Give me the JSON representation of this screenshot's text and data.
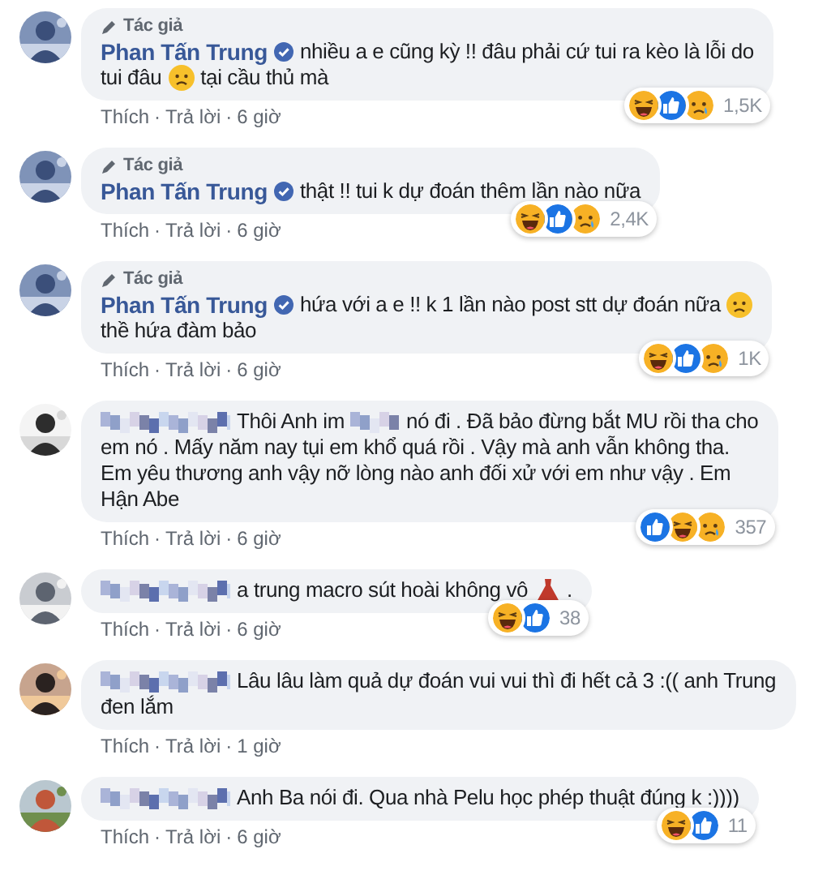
{
  "separator": "·",
  "comments": [
    {
      "avatar": {
        "kind": "picture"
      },
      "author_badge": "Tác giả",
      "name": "Phan Tấn Trung",
      "verified": true,
      "lines": [
        [
          {
            "kind": "text",
            "text": "nhiều a e cũng kỳ !! đâu phải cứ tui ra kèo là lỗi do"
          }
        ],
        [
          {
            "kind": "text",
            "text": "tui đâu"
          },
          {
            "kind": "frown"
          },
          {
            "kind": "text",
            "text": "tại cầu thủ mà"
          }
        ]
      ],
      "reactions": [
        {
          "kind": "haha"
        },
        {
          "kind": "like"
        },
        {
          "kind": "sad"
        }
      ],
      "reaction_count": "1,5K",
      "actions": [
        "Thích",
        "Trả lời"
      ],
      "time": "6 giờ"
    },
    {
      "avatar": {
        "kind": "picture"
      },
      "author_badge": "Tác giả",
      "name": "Phan Tấn Trung",
      "verified": true,
      "lines": [
        [
          {
            "kind": "text",
            "text": "thật !! tui k dự đoán thêm lần nào nữa"
          }
        ]
      ],
      "reactions": [
        {
          "kind": "haha"
        },
        {
          "kind": "like"
        },
        {
          "kind": "sad"
        }
      ],
      "reaction_count": "2,4K",
      "actions": [
        "Thích",
        "Trả lời"
      ],
      "time": "6 giờ"
    },
    {
      "avatar": {
        "kind": "picture"
      },
      "author_badge": "Tác giả",
      "name": "Phan Tấn Trung",
      "verified": true,
      "lines": [
        [
          {
            "kind": "text",
            "text": "hứa với a e !! k 1 lần nào post stt dự đoán nữa"
          },
          {
            "kind": "frown"
          }
        ],
        [
          {
            "kind": "text",
            "text": "thề hứa đàm bảo"
          }
        ]
      ],
      "reactions": [
        {
          "kind": "haha"
        },
        {
          "kind": "like"
        },
        {
          "kind": "sad"
        }
      ],
      "reaction_count": "1K",
      "actions": [
        "Thích",
        "Trả lời"
      ],
      "time": "6 giờ"
    },
    {
      "avatar": {
        "kind": "picture"
      },
      "lines": [
        [
          {
            "kind": "redacted"
          },
          {
            "kind": "text",
            "text": "Thôi Anh im"
          },
          {
            "kind": "redacted"
          },
          {
            "kind": "text",
            "text": "nó đi . Đã bảo đừng bắt MU rồi tha cho"
          }
        ],
        [
          {
            "kind": "text",
            "text": "em nó . Mấy năm nay tụi em khổ quá rồi . Vậy mà anh vẫn không tha."
          }
        ],
        [
          {
            "kind": "text",
            "text": "Em yêu thương anh vậy nỡ lòng nào anh đối xử với em như vậy . Em"
          }
        ],
        [
          {
            "kind": "text",
            "text": "Hận Abe"
          }
        ]
      ],
      "reactions": [
        {
          "kind": "like"
        },
        {
          "kind": "haha"
        },
        {
          "kind": "sad"
        }
      ],
      "reaction_count": "357",
      "actions": [
        "Thích",
        "Trả lời"
      ],
      "time": "6 giờ"
    },
    {
      "avatar": {
        "kind": "picture"
      },
      "lines": [
        [
          {
            "kind": "redacted"
          },
          {
            "kind": "text",
            "text": "a trung macro sút hoài không vô"
          },
          {
            "kind": "dress"
          },
          {
            "kind": "text",
            "text": "."
          }
        ]
      ],
      "reactions": [
        {
          "kind": "haha"
        },
        {
          "kind": "like"
        }
      ],
      "reaction_count": "38",
      "actions": [
        "Thích",
        "Trả lời"
      ],
      "time": "6 giờ"
    },
    {
      "avatar": {
        "kind": "picture"
      },
      "lines": [
        [
          {
            "kind": "redacted"
          },
          {
            "kind": "text",
            "text": "Lâu lâu làm quả dự đoán vui vui thì đi hết cả 3 :(( anh Trung"
          }
        ],
        [
          {
            "kind": "text",
            "text": "đen lắm"
          }
        ]
      ],
      "actions": [
        "Thích",
        "Trả lời"
      ],
      "time": "1 giờ"
    },
    {
      "avatar": {
        "kind": "picture"
      },
      "lines": [
        [
          {
            "kind": "redacted"
          },
          {
            "kind": "text",
            "text": "Anh Ba nói đi. Qua nhà Pelu học phép thuật đúng k :))))"
          }
        ]
      ],
      "reactions": [
        {
          "kind": "haha"
        },
        {
          "kind": "like"
        }
      ],
      "reaction_count": "11",
      "actions": [
        "Thích",
        "Trả lời"
      ],
      "time": "6 giờ"
    }
  ]
}
